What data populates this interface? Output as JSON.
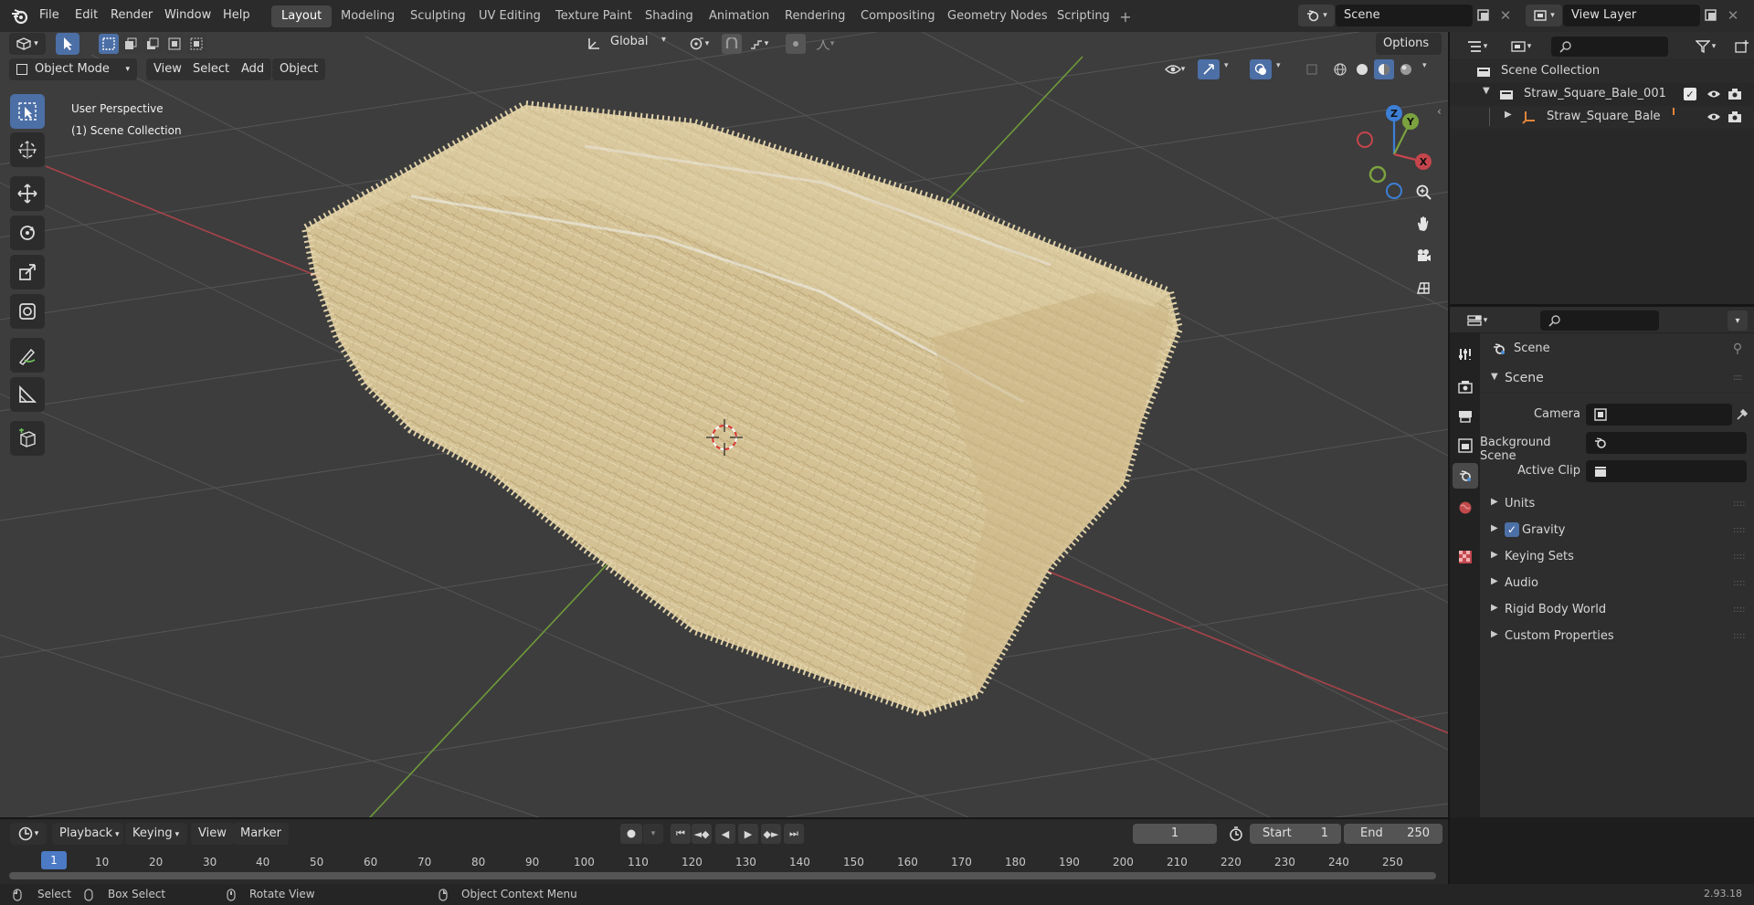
{
  "menu": {
    "items": [
      "File",
      "Edit",
      "Render",
      "Window",
      "Help"
    ]
  },
  "workspaces": [
    "Layout",
    "Modeling",
    "Sculpting",
    "UV Editing",
    "Texture Paint",
    "Shading",
    "Animation",
    "Rendering",
    "Compositing",
    "Geometry Nodes",
    "Scripting"
  ],
  "scene_field": "Scene",
  "viewlayer_field": "View Layer",
  "viewport": {
    "mode": "Object Mode",
    "menus": [
      "View",
      "Select",
      "Add",
      "Object"
    ],
    "transform_orientation": "Global",
    "options_label": "Options",
    "overlay_line1": "User Perspective",
    "overlay_line2": "(1) Scene Collection",
    "gizmo_axes": {
      "z": "Z",
      "y": "Y",
      "x": "X"
    }
  },
  "outliner": {
    "root": "Scene Collection",
    "collection": "Straw_Square_Bale_001",
    "object": "Straw_Square_Bale"
  },
  "properties": {
    "header_title": "Scene",
    "panel": "Scene",
    "rows": [
      {
        "label": "Camera"
      },
      {
        "label": "Background Scene"
      },
      {
        "label": "Active Clip"
      }
    ],
    "subpanels": [
      "Units",
      "Gravity",
      "Keying Sets",
      "Audio",
      "Rigid Body World",
      "Custom Properties"
    ],
    "gravity_checked": true
  },
  "timeline": {
    "menus": [
      "Playback",
      "Keying",
      "View",
      "Marker"
    ],
    "current_frame": "1",
    "start_label": "Start",
    "start_value": "1",
    "end_label": "End",
    "end_value": "250",
    "ruler": [
      "1",
      "10",
      "20",
      "30",
      "40",
      "50",
      "60",
      "70",
      "80",
      "90",
      "100",
      "110",
      "120",
      "130",
      "140",
      "150",
      "160",
      "170",
      "180",
      "190",
      "200",
      "210",
      "220",
      "230",
      "240",
      "250"
    ]
  },
  "status": {
    "select": "Select",
    "box_select": "Box Select",
    "rotate_view": "Rotate View",
    "context_menu": "Object Context Menu",
    "version": "2.93.18"
  },
  "colors": {
    "accent": "#4c6fa6",
    "x_axis": "#c4454c",
    "y_axis": "#7ba23f",
    "z_axis": "#3d7fd6",
    "straw": "#d9c79a"
  }
}
